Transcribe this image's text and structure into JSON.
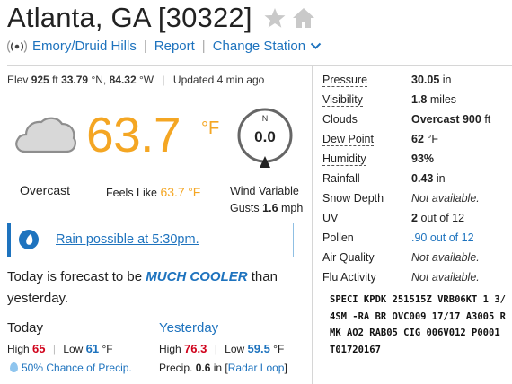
{
  "header": {
    "title": "Atlanta, GA [30322]",
    "station": "Emory/Druid Hills",
    "report": "Report",
    "change_station": "Change Station"
  },
  "elev": {
    "label": "Elev",
    "value": "925",
    "unit_ft": "ft",
    "lat": "33.79",
    "lat_dir": "°N,",
    "lon": "84.32",
    "lon_dir": "°W",
    "updated": "Updated 4 min ago"
  },
  "current": {
    "temp": "63.7",
    "temp_unit": "°F",
    "condition": "Overcast",
    "feels_like_label": "Feels Like",
    "feels_like_value": "63.7",
    "feels_like_unit": "°F",
    "wind_label": "Wind Variable",
    "gusts_label": "Gusts",
    "gusts_value": "1.6",
    "gusts_unit": "mph",
    "compass_dir": "N",
    "compass_speed": "0.0"
  },
  "alert": {
    "text": "Rain possible at 5:30pm."
  },
  "forecast": {
    "prefix": "Today is forecast to be",
    "highlight": "MUCH COOLER",
    "suffix": "than yesterday."
  },
  "today": {
    "heading": "Today",
    "high_label": "High",
    "high": "65",
    "low_label": "Low",
    "low": "61",
    "unit": "°F",
    "precip_pct": "50%",
    "precip_label": "Chance of Precip."
  },
  "yesterday": {
    "heading": "Yesterday",
    "high_label": "High",
    "high": "76.3",
    "low_label": "Low",
    "low": "59.5",
    "unit": "°F",
    "precip_label": "Precip.",
    "precip_value": "0.6",
    "precip_unit": "in",
    "radar_link": "Radar Loop"
  },
  "conditions": [
    {
      "label": "Pressure",
      "value": "30.05",
      "unit": "in",
      "dashed": true
    },
    {
      "label": "Visibility",
      "value": "1.8",
      "unit": "miles",
      "dashed": true
    },
    {
      "label": "Clouds",
      "value": "Overcast 900",
      "unit": "ft",
      "dashed": false
    },
    {
      "label": "Dew Point",
      "value": "62",
      "unit": "°F",
      "dashed": true
    },
    {
      "label": "Humidity",
      "value": "93%",
      "unit": "",
      "dashed": true
    },
    {
      "label": "Rainfall",
      "value": "0.43",
      "unit": "in",
      "dashed": false
    },
    {
      "label": "Snow Depth",
      "value": "Not available.",
      "unit": "",
      "dashed": true,
      "na": true
    },
    {
      "label": "UV",
      "value": "2",
      "unit": "out of 12",
      "dashed": false
    },
    {
      "label": "Pollen",
      "value": ".90",
      "unit": "out of 12",
      "dashed": false,
      "blue": true
    },
    {
      "label": "Air Quality",
      "value": "Not available.",
      "unit": "",
      "dashed": false,
      "na": true
    },
    {
      "label": "Flu Activity",
      "value": "Not available.",
      "unit": "",
      "dashed": false,
      "na": true
    }
  ],
  "metar": "SPECI KPDK 251515Z VRB06KT 1 3/4SM -RA BR OVC009 17/17 A3005 RMK AO2 RAB05 CIG 006V012 P0001 T01720167",
  "colors": {
    "accent": "#1e73be",
    "temp": "#f4a623",
    "high": "#d0021b"
  }
}
